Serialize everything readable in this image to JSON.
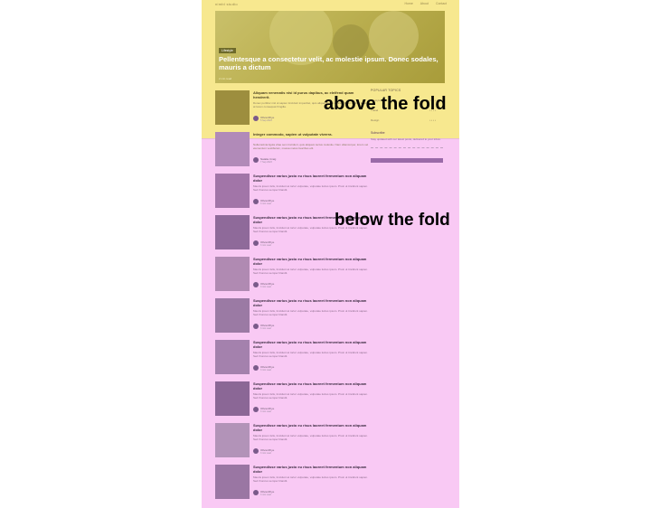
{
  "nav": {
    "logo": "nimbl studio",
    "links": [
      "Home",
      "About",
      "Contact"
    ]
  },
  "hero": {
    "tag": "Lifestyle",
    "title": "Pellentesque a consectetur velit, ac molestie ipsum. Donec sodales, mauris a dictum",
    "meta": "2 min read"
  },
  "annotations": {
    "above": "above the fold",
    "below": "below the fold"
  },
  "featured_cards": [
    {
      "title": "Aliquam venenatis nisi id purus dapibus, ac eleifend quam hendrerit.",
      "excerpt": "Donec porttitor nisl ut sapien tincidunt imperdiet, quis aliquet ipsum ultrices. Proin sagittis lectus at lorem consequat fringilla.",
      "author": "Olivia Rhye",
      "date": "5 Sep 2023"
    },
    {
      "title": "Integer commodo, sapien ut vulputate viverra.",
      "excerpt": "Nulla lacinia ligula vitae sem tincidunt, quis aliquam lectus molestie. Nam ullamcorper, lorem vel elementum vestibulum, massa metus faucibus elit.",
      "author": "Natalie Craig",
      "date": "7 Sep 2023"
    }
  ],
  "cards": [
    {
      "title": "Suspendisse varius justo eu risus laoreet fermentum non aliquam dolor",
      "excerpt": "Mauris ipsum felis, tincidunt at tortor vulputate, vulputate luctus ipsum. Proin ut tincidunt sapien. Sed rhoncus semper blandit.",
      "author": "Olivia Rhye",
      "date": "3 min read"
    },
    {
      "title": "Suspendisse varius justo eu risus laoreet fermentum non aliquam dolor",
      "excerpt": "Mauris ipsum felis, tincidunt at tortor vulputate, vulputate luctus ipsum. Proin ut tincidunt sapien. Sed rhoncus semper blandit.",
      "author": "Olivia Rhye",
      "date": "3 min read"
    },
    {
      "title": "Suspendisse varius justo eu risus laoreet fermentum non aliquam dolor",
      "excerpt": "Mauris ipsum felis, tincidunt at tortor vulputate, vulputate luctus ipsum. Proin ut tincidunt sapien. Sed rhoncus semper blandit.",
      "author": "Olivia Rhye",
      "date": "3 min read"
    },
    {
      "title": "Suspendisse varius justo eu risus laoreet fermentum non aliquam dolor",
      "excerpt": "Mauris ipsum felis, tincidunt at tortor vulputate, vulputate luctus ipsum. Proin ut tincidunt sapien. Sed rhoncus semper blandit.",
      "author": "Olivia Rhye",
      "date": "3 min read"
    },
    {
      "title": "Suspendisse varius justo eu risus laoreet fermentum non aliquam dolor",
      "excerpt": "Mauris ipsum felis, tincidunt at tortor vulputate, vulputate luctus ipsum. Proin ut tincidunt sapien. Sed rhoncus semper blandit.",
      "author": "Olivia Rhye",
      "date": "3 min read"
    },
    {
      "title": "Suspendisse varius justo eu risus laoreet fermentum non aliquam dolor",
      "excerpt": "Mauris ipsum felis, tincidunt at tortor vulputate, vulputate luctus ipsum. Proin ut tincidunt sapien. Sed rhoncus semper blandit.",
      "author": "Olivia Rhye",
      "date": "3 min read"
    },
    {
      "title": "Suspendisse varius justo eu risus laoreet fermentum non aliquam dolor",
      "excerpt": "Mauris ipsum felis, tincidunt at tortor vulputate, vulputate luctus ipsum. Proin ut tincidunt sapien. Sed rhoncus semper blandit.",
      "author": "Olivia Rhye",
      "date": "3 min read"
    },
    {
      "title": "Suspendisse varius justo eu risus laoreet fermentum non aliquam dolor",
      "excerpt": "Mauris ipsum felis, tincidunt at tortor vulputate, vulputate luctus ipsum. Proin ut tincidunt sapien. Sed rhoncus semper blandit.",
      "author": "Olivia Rhye",
      "date": "3 min read"
    }
  ],
  "sidebar": {
    "popular_heading": "POPULAR TOPICS",
    "topics": [
      {
        "label": "Lifestyle",
        "count": "• • • •"
      },
      {
        "label": "Travel",
        "count": "• • • •"
      },
      {
        "label": "Design",
        "count": "• • • •"
      }
    ],
    "subscribe_heading": "Subscribe",
    "subscribe_text": "Stay updated with our latest posts, delivered to your inbox.",
    "email_placeholder": "Your email address"
  },
  "colors": {
    "above_fold": "#f7e88f",
    "below_fold": "#f9c9f4"
  }
}
